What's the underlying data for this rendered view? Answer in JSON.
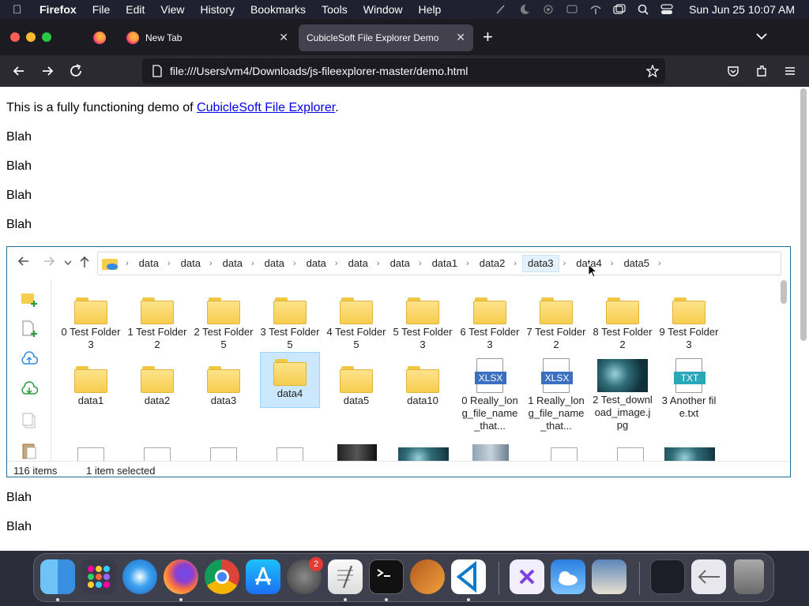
{
  "menubar": {
    "app_name": "Firefox",
    "items": [
      "File",
      "Edit",
      "View",
      "History",
      "Bookmarks",
      "Tools",
      "Window",
      "Help"
    ],
    "clock": "Sun Jun 25  10:07 AM"
  },
  "browser": {
    "tabs": [
      {
        "title": "New Tab"
      },
      {
        "title": "CubicleSoft File Explorer Demo",
        "active": true
      }
    ],
    "new_tab_label": "+",
    "url": "file:///Users/vm4/Downloads/js-fileexplorer-master/demo.html"
  },
  "page": {
    "intro_before": "This is a fully functioning demo of ",
    "intro_link": "CubicleSoft File Explorer",
    "intro_after": ".",
    "blah": "Blah"
  },
  "explorer": {
    "breadcrumbs": [
      "data",
      "data",
      "data",
      "data",
      "data",
      "data",
      "data",
      "data1",
      "data2",
      "data3",
      "data4",
      "data5"
    ],
    "items": [
      {
        "name": "0 Test Folder 3",
        "type": "folder"
      },
      {
        "name": "1 Test Folder 2",
        "type": "folder"
      },
      {
        "name": "2 Test Folder 5",
        "type": "folder"
      },
      {
        "name": "3 Test Folder 5",
        "type": "folder"
      },
      {
        "name": "4 Test Folder 5",
        "type": "folder"
      },
      {
        "name": "5 Test Folder 3",
        "type": "folder"
      },
      {
        "name": "6 Test Folder 3",
        "type": "folder"
      },
      {
        "name": "7 Test Folder 2",
        "type": "folder"
      },
      {
        "name": "8 Test Folder 2",
        "type": "folder"
      },
      {
        "name": "9 Test Folder 3",
        "type": "folder"
      },
      {
        "name": "data1",
        "type": "folder"
      },
      {
        "name": "data2",
        "type": "folder"
      },
      {
        "name": "data3",
        "type": "folder"
      },
      {
        "name": "data4",
        "type": "folder",
        "selected": true
      },
      {
        "name": "data5",
        "type": "folder"
      },
      {
        "name": "data10",
        "type": "folder"
      },
      {
        "name": "0 Really_long_file_name_that...",
        "type": "file",
        "badge": "XLSX"
      },
      {
        "name": "1 Really_long_file_name_that...",
        "type": "file",
        "badge": "XLSX"
      },
      {
        "name": "2 Test_download_image.jpg",
        "type": "image"
      },
      {
        "name": "3 Another file.txt",
        "type": "file",
        "badge": "TXT"
      }
    ],
    "status_count": "116 items",
    "status_selected": "1 item selected"
  },
  "colors": {
    "folder": "#f6cd4f",
    "selection": "#cce8ff",
    "border": "#1e6e96",
    "xlsx_badge": "#3b6fc2",
    "txt_badge": "#2aa7b8"
  }
}
